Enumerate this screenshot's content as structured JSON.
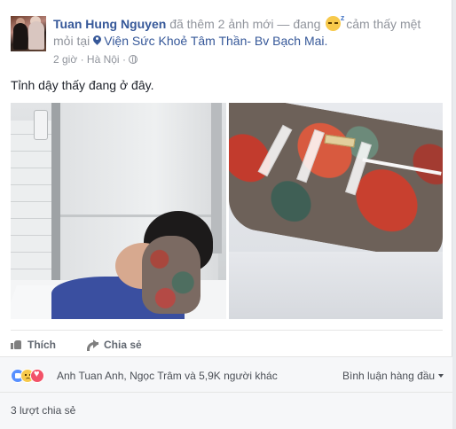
{
  "post": {
    "author": "Tuan Hung Nguyen",
    "verb": "đã thêm 2 ảnh mới — đang",
    "feeling": "cảm thấy mệt mỏi tại",
    "location": "Viện Sức Khoẻ Tâm Thần- Bv Bạch Mai.",
    "time": "2 giờ",
    "separator": "·",
    "city": "Hà Nội",
    "text": "Tỉnh dậy thấy đang ở đây."
  },
  "actions": {
    "like_label": "Thích",
    "share_label": "Chia sẻ"
  },
  "reactions": {
    "summary": "Anh Tuan Anh, Ngọc Trâm và 5,9K người khác",
    "sort_label": "Bình luận hàng đầu"
  },
  "shares": {
    "count_label": "3 lượt chia sẻ"
  },
  "colors": {
    "link": "#365899",
    "meta": "#90949c",
    "like_reaction": "#5890ff",
    "sad_reaction": "#f7c94b",
    "love_reaction": "#f25268"
  }
}
